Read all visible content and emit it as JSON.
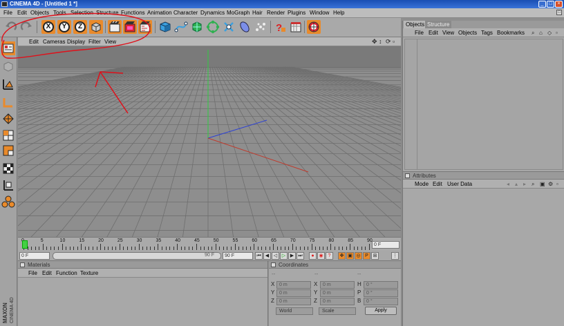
{
  "window": {
    "title": "CINEMA 4D - [Untitled 1 *]"
  },
  "menubar": {
    "items": [
      "File",
      "Edit",
      "Objects",
      "Tools",
      "Selection",
      "Structure",
      "Functions",
      "Animation",
      "Character",
      "Dynamics",
      "MoGraph",
      "Hair",
      "Render",
      "Plugins",
      "Window",
      "Help"
    ]
  },
  "toolbar": {
    "axis_x": "X",
    "axis_y": "Y",
    "axis_z": "Z",
    "icons": [
      "undo-icon",
      "redo-icon",
      "x-axis-lock-icon",
      "y-axis-lock-icon",
      "z-axis-lock-icon",
      "coordinate-system-icon",
      "render-view-icon",
      "render-picture-viewer-icon",
      "render-settings-icon",
      "cube-primitive-icon",
      "spline-pen-icon",
      "nurbs-icon",
      "array-icon",
      "deformer-icon",
      "scene-light-icon",
      "particle-icon",
      "help-icon",
      "scene-icon",
      "camera-target-icon"
    ]
  },
  "viewport": {
    "menu": [
      "Edit",
      "Cameras",
      "Display",
      "Filter",
      "View"
    ]
  },
  "timeline": {
    "ticks": [
      "0",
      "5",
      "10",
      "15",
      "20",
      "25",
      "30",
      "35",
      "40",
      "45",
      "50",
      "55",
      "60",
      "65",
      "70",
      "75",
      "80",
      "85",
      "90"
    ],
    "current_frame": "0 F",
    "start_frame": "0 F",
    "end_frame_inner": "90 F",
    "end_frame": "90 F"
  },
  "materials": {
    "title": "Materials",
    "menu": [
      "File",
      "Edit",
      "Function",
      "Texture"
    ]
  },
  "coordinates": {
    "title": "Coordinates",
    "rows": [
      {
        "a": "X",
        "av": "0 m",
        "b": "X",
        "bv": "0 m",
        "c": "H",
        "cv": "0 °"
      },
      {
        "a": "Y",
        "av": "0 m",
        "b": "Y",
        "bv": "0 m",
        "c": "P",
        "cv": "0 °"
      },
      {
        "a": "Z",
        "av": "0 m",
        "b": "Z",
        "bv": "0 m",
        "c": "B",
        "cv": "0 °"
      }
    ],
    "mode1": "World",
    "mode2": "Scale",
    "apply": "Apply"
  },
  "objects_panel": {
    "tabs": [
      "Objects",
      "Structure"
    ],
    "menu": [
      "File",
      "Edit",
      "View",
      "Objects",
      "Tags",
      "Bookmarks"
    ]
  },
  "attributes_panel": {
    "title": "Attributes",
    "menu": [
      "Mode",
      "Edit",
      "User Data"
    ]
  },
  "branding": {
    "logo_text": "MAXON CINEMA 4D"
  },
  "colors": {
    "accent_orange": "#e98a2b",
    "titlebar_blue": "#1a4fb3",
    "viewport_grey": "#8c8c8c",
    "axis_red": "#c0392b",
    "axis_green": "#2ecc40",
    "axis_blue": "#2a3fd6",
    "annotation_red": "#e0101a"
  }
}
